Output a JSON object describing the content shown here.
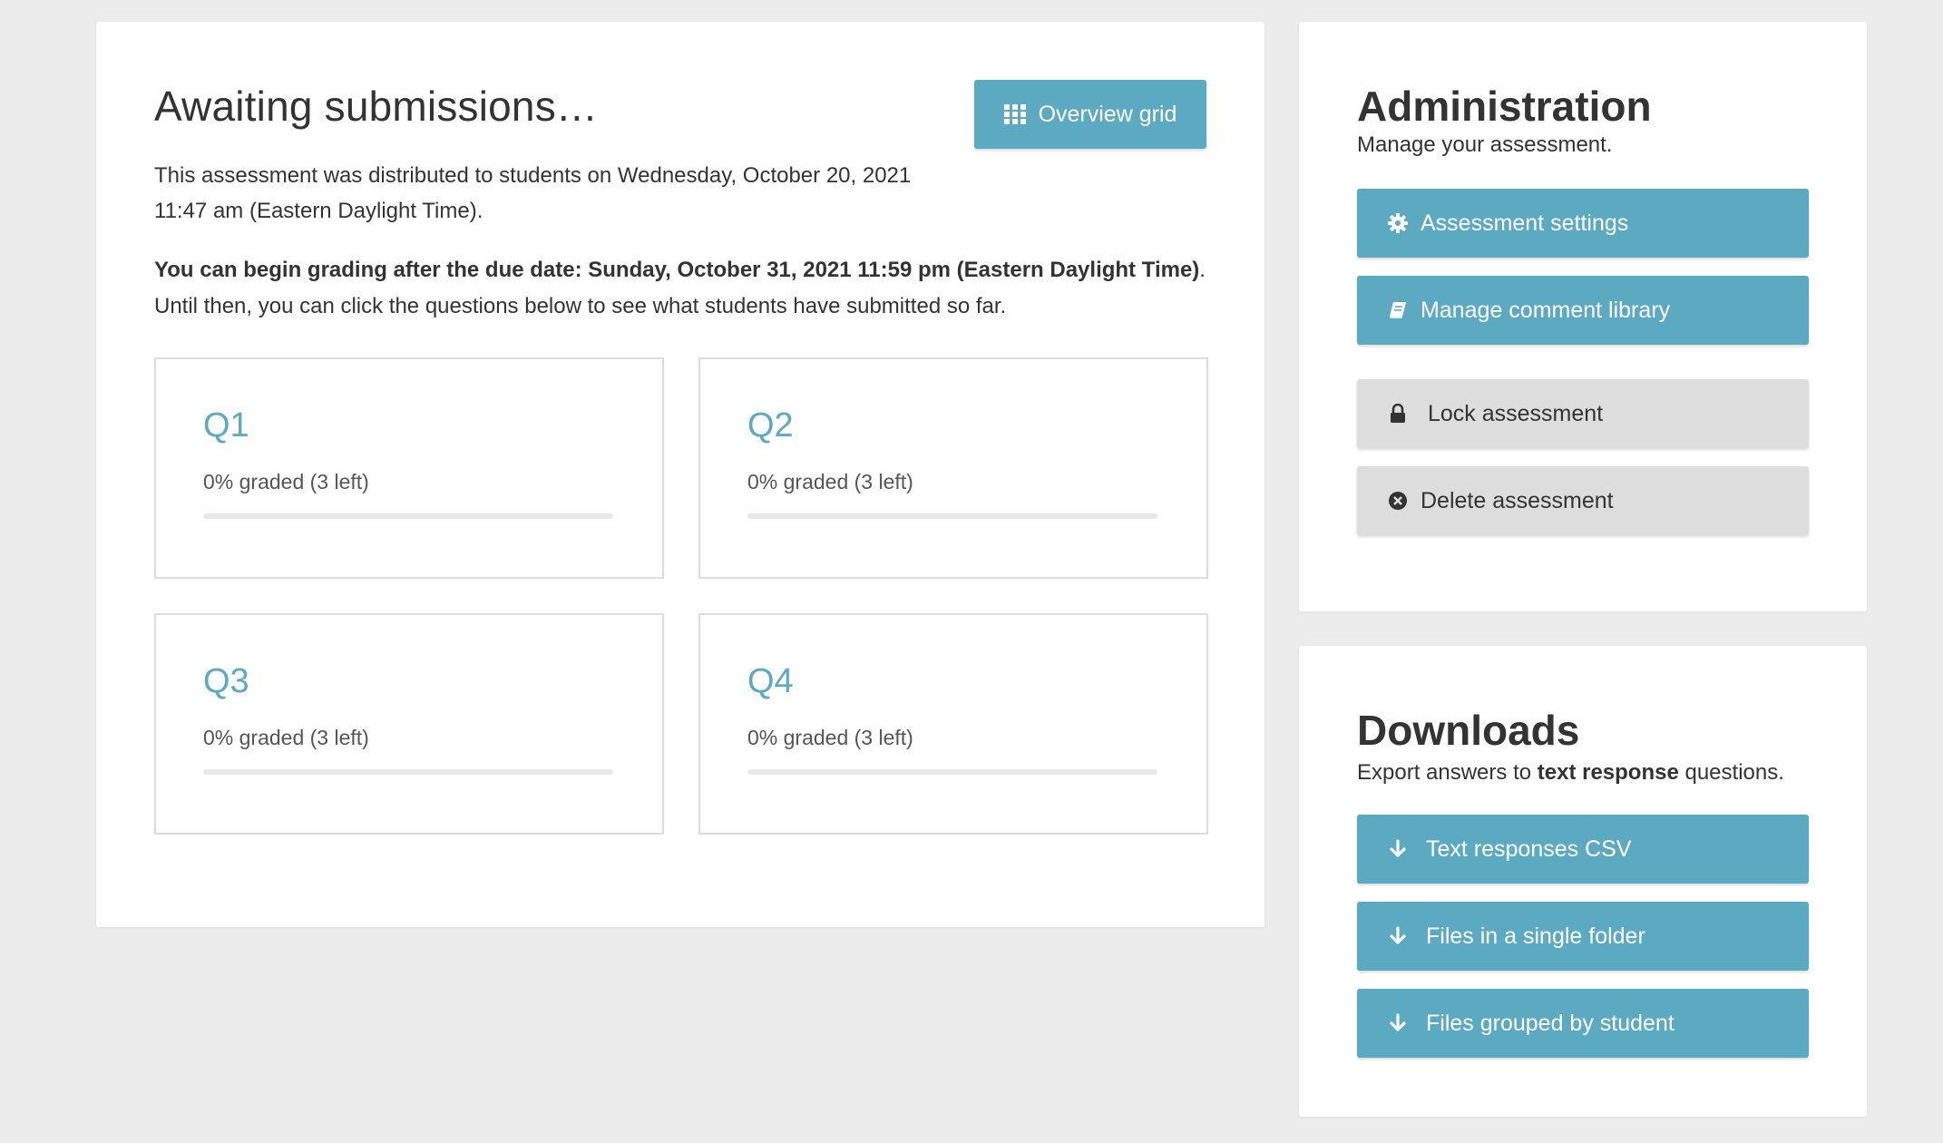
{
  "main": {
    "title": "Awaiting submissions…",
    "overview_button": "Overview grid",
    "distribution_text_line1": "This assessment was distributed to students on Wednesday, October 20, 2021",
    "distribution_text_line2": "11:47 am (Eastern Daylight Time).",
    "grading_note_bold": "You can begin grading after the due date: Sunday, October 31, 2021 11:59 pm (Eastern Daylight Time)",
    "grading_note_period": ".",
    "grading_note_rest": "Until then, you can click the questions below to see what students have submitted so far.",
    "questions": [
      {
        "label": "Q1",
        "progress_text": "0% graded (3 left)",
        "progress": 0
      },
      {
        "label": "Q2",
        "progress_text": "0% graded (3 left)",
        "progress": 0
      },
      {
        "label": "Q3",
        "progress_text": "0% graded (3 left)",
        "progress": 0
      },
      {
        "label": "Q4",
        "progress_text": "0% graded (3 left)",
        "progress": 0
      }
    ]
  },
  "administration": {
    "title": "Administration",
    "subtitle": "Manage your assessment.",
    "buttons": [
      {
        "label": "Assessment settings",
        "icon": "gear-icon"
      },
      {
        "label": "Manage comment library",
        "icon": "book-icon"
      },
      {
        "label": "Lock assessment",
        "icon": "lock-icon"
      },
      {
        "label": "Delete assessment",
        "icon": "times-circle-icon"
      }
    ]
  },
  "downloads": {
    "title": "Downloads",
    "subtitle_pre": "Export answers to ",
    "subtitle_bold": "text response",
    "subtitle_post": " questions.",
    "buttons": [
      {
        "label": "Text responses CSV",
        "icon": "arrow-down-icon"
      },
      {
        "label": "Files in a single folder",
        "icon": "arrow-down-icon"
      },
      {
        "label": "Files grouped by student",
        "icon": "arrow-down-icon"
      }
    ]
  },
  "colors": {
    "accent": "#5ca9c2",
    "background": "#ececec",
    "gray_button": "#dddddd"
  }
}
